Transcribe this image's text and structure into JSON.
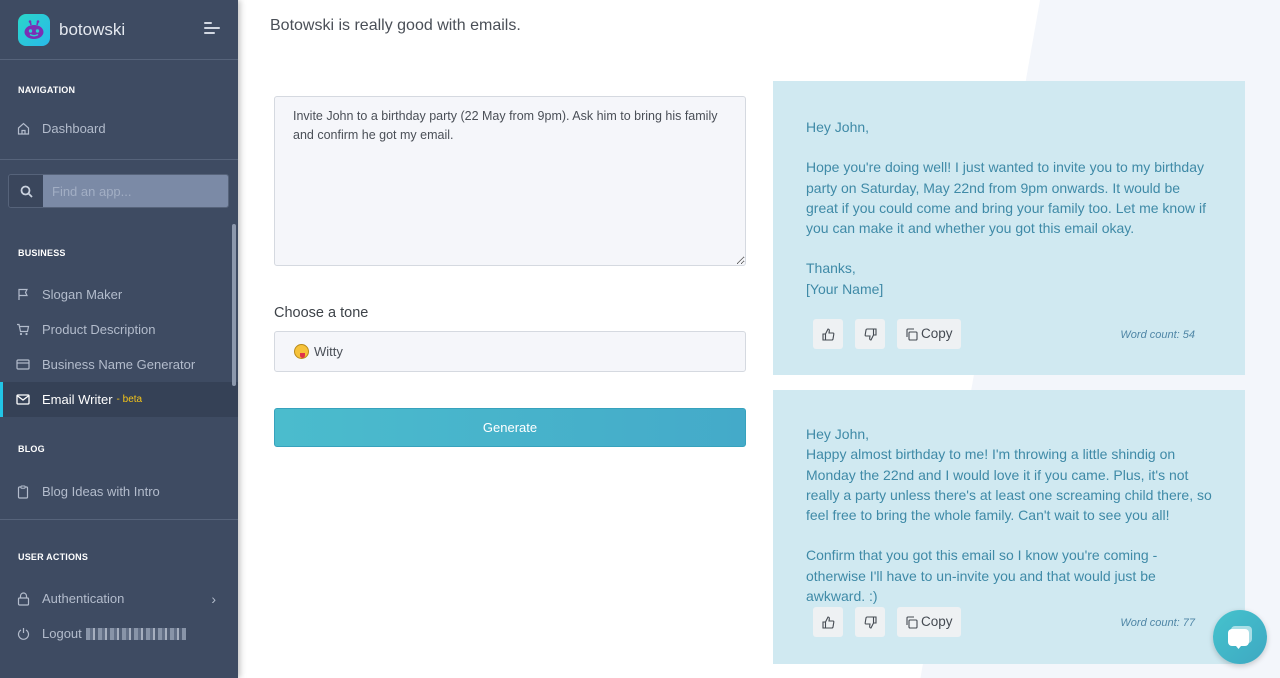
{
  "app": {
    "brand_name": "botowski",
    "page_heading": "Botowski is really good with emails."
  },
  "sidebar": {
    "sections": {
      "navigation": "NAVIGATION",
      "business": "BUSINESS",
      "blog": "BLOG",
      "user_actions": "USER ACTIONS"
    },
    "dashboard": {
      "label": "Dashboard",
      "icon": "home-icon"
    },
    "search": {
      "placeholder": "Find an app..."
    },
    "business_items": [
      {
        "label": "Slogan Maker",
        "icon": "flag-icon"
      },
      {
        "label": "Product Description",
        "icon": "cart-icon"
      },
      {
        "label": "Business Name Generator",
        "icon": "card-icon"
      },
      {
        "label": "Email Writer",
        "badge": "- beta",
        "icon": "mail-icon",
        "active": true
      }
    ],
    "blog_items": [
      {
        "label": "Blog Ideas with Intro",
        "icon": "clipboard-icon"
      }
    ],
    "user_items": [
      {
        "label": "Authentication",
        "icon": "lock-icon"
      },
      {
        "label": "Logout",
        "icon": "power-icon"
      }
    ]
  },
  "form": {
    "prompt_value": "Invite John to a birthday party (22 May from 9pm). Ask him to bring his family and confirm he got my email.",
    "tone_label": "Choose a tone",
    "tone_selected": "Witty",
    "generate_label": "Generate"
  },
  "results": [
    {
      "greeting": "Hey John,",
      "paragraphs": [
        "Hope you're doing well! I just wanted to invite you to my birthday party on Saturday, May 22nd from 9pm onwards. It would be great if you could come and bring your family too. Let me know if you can make it and whether you got this email okay."
      ],
      "signoff": "Thanks,",
      "signature": "[Your Name]",
      "copy_label": "Copy",
      "word_count": "Word count: 54"
    },
    {
      "greeting": "Hey John,",
      "paragraphs": [
        "Happy almost birthday to me! I'm throwing a little shindig on Monday the 22nd and I would love it if you came. Plus, it's not really a party unless there's at least one screaming child there, so feel free to bring the whole family. Can't wait to see you all!",
        "Confirm that you got this email so I know you're coming - otherwise I'll have to un-invite you and that would just be awkward. :)"
      ],
      "copy_label": "Copy",
      "word_count": "Word count: 77"
    }
  ],
  "colors": {
    "sidebar_bg": "#3e4b62",
    "accent": "#22c5e6",
    "beta": "#f5c518",
    "card_bg": "#d0e9f1",
    "button": "#4bbccd"
  }
}
